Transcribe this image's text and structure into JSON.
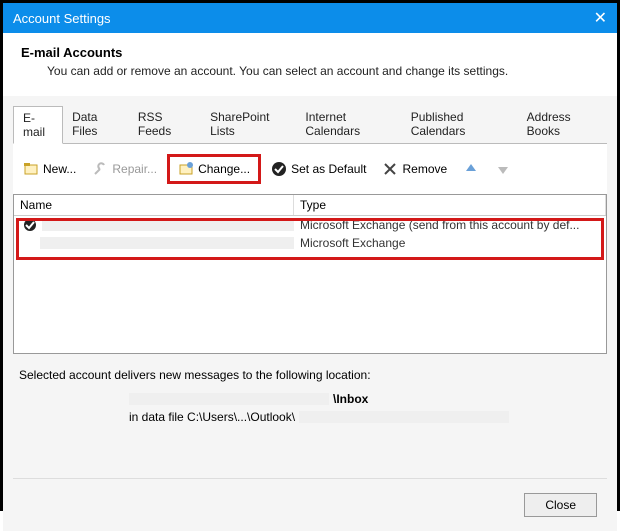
{
  "window": {
    "title": "Account Settings",
    "close_label": "✕"
  },
  "header": {
    "title": "E-mail Accounts",
    "subtitle": "You can add or remove an account. You can select an account and change its settings."
  },
  "tabs": [
    {
      "label": "E-mail",
      "active": true
    },
    {
      "label": "Data Files",
      "active": false
    },
    {
      "label": "RSS Feeds",
      "active": false
    },
    {
      "label": "SharePoint Lists",
      "active": false
    },
    {
      "label": "Internet Calendars",
      "active": false
    },
    {
      "label": "Published Calendars",
      "active": false
    },
    {
      "label": "Address Books",
      "active": false
    }
  ],
  "toolbar": {
    "new_label": "New...",
    "repair_label": "Repair...",
    "change_label": "Change...",
    "set_default_label": "Set as Default",
    "remove_label": "Remove"
  },
  "columns": {
    "name": "Name",
    "type": "Type"
  },
  "rows": [
    {
      "name": "",
      "type": "Microsoft Exchange (send from this account by def...",
      "default": true
    },
    {
      "name": "",
      "type": "Microsoft Exchange",
      "default": false
    }
  ],
  "footer": {
    "line1": "Selected account delivers new messages to the following location:",
    "inbox_suffix": "\\Inbox",
    "datafile_prefix": "in data file C:\\Users\\...\\Outlook\\"
  },
  "buttons": {
    "close": "Close"
  }
}
